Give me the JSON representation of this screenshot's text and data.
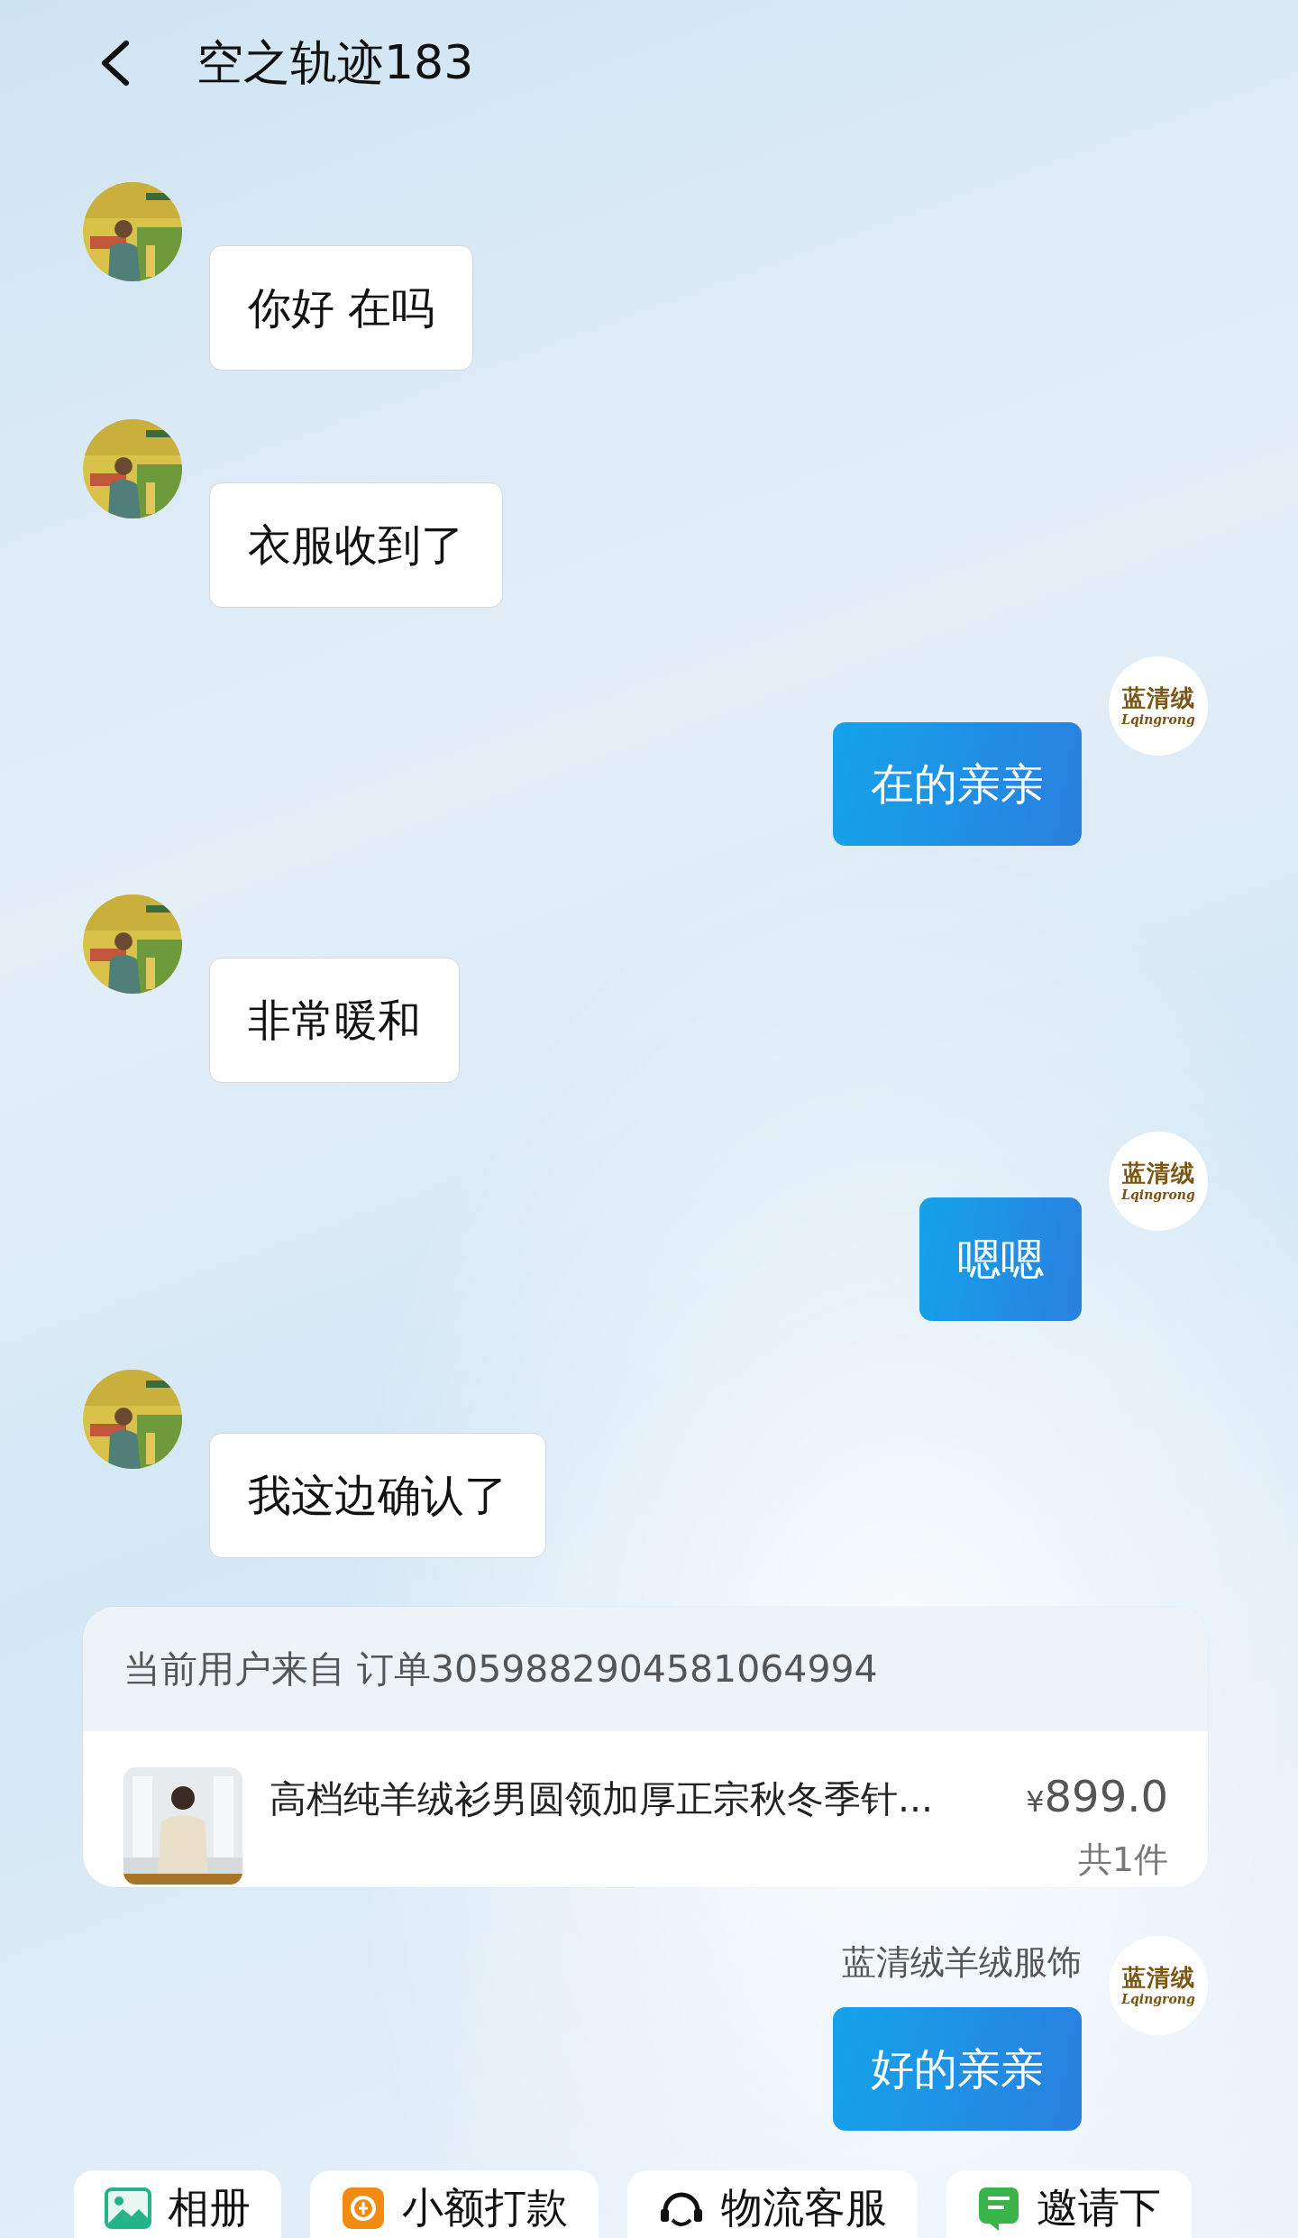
{
  "header": {
    "title": "空之轨迹183"
  },
  "messages": [
    {
      "kind": "received",
      "text": "你好 在吗"
    },
    {
      "kind": "received",
      "text": "衣服收到了"
    },
    {
      "kind": "sent",
      "text": "在的亲亲",
      "logo": {
        "name": "蓝清绒",
        "latin": "Lqingrong"
      }
    },
    {
      "kind": "received",
      "text": "非常暖和"
    },
    {
      "kind": "sent",
      "text": "嗯嗯",
      "logo": {
        "name": "蓝清绒",
        "latin": "Lqingrong"
      }
    },
    {
      "kind": "received",
      "text": "我这边确认了"
    },
    {
      "kind": "order",
      "source": "当前用户来自 订单3059882904581064994",
      "product": {
        "title": "高档纯羊绒衫男圆领加厚正宗秋冬季针...",
        "currency": "¥",
        "price": "899.0",
        "count": "共1件"
      }
    },
    {
      "kind": "sent",
      "sender": "蓝清绒羊绒服饰",
      "text": "好的亲亲",
      "logo": {
        "name": "蓝清绒",
        "latin": "Lqingrong"
      }
    }
  ],
  "quick_actions": [
    {
      "kind": "album",
      "label": "相册"
    },
    {
      "kind": "payment",
      "label": "小额打款"
    },
    {
      "kind": "logistics",
      "label": "物流客服"
    },
    {
      "kind": "invite",
      "label": "邀请下"
    }
  ]
}
